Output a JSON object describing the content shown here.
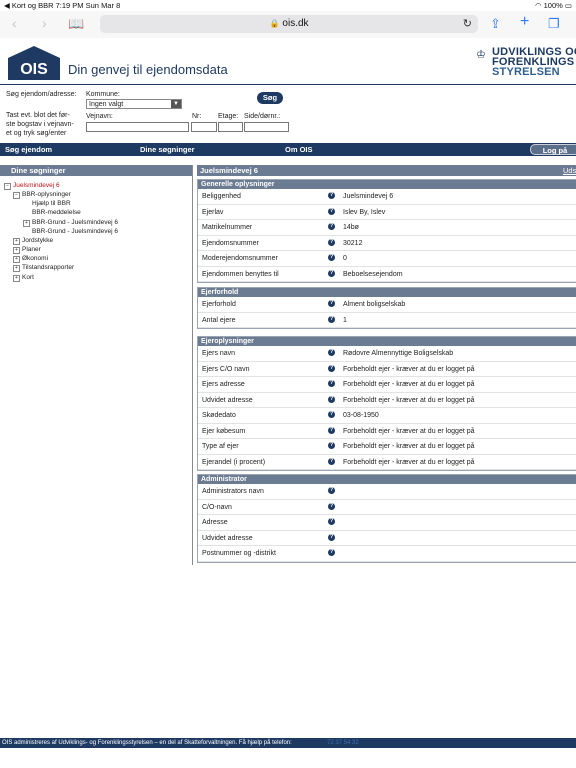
{
  "status": {
    "left": "◀ Kort og BBR   7:19 PM   Sun Mar 8",
    "right": "100%"
  },
  "browser": {
    "url": "ois.dk"
  },
  "header": {
    "logo_text": "OIS",
    "tagline": "Din genvej til ejendomsdata",
    "agency_line1": "UDVIKLINGS OG",
    "agency_line2": "FORENKLINGS",
    "agency_line3": "STYRELSEN"
  },
  "search": {
    "label_search": "Søg ejendom/adresse:",
    "label_kommune": "Kommune:",
    "kommune_selected": "Ingen valgt",
    "search_button": "Søg",
    "help_text_1": "Tast evt. blot det før-",
    "help_text_2": "ste bogstav i vejnavn-",
    "help_text_3": "et og tryk søg/enter",
    "label_vejnavn": "Vejnavn:",
    "label_nr": "Nr:",
    "label_etage": "Etage:",
    "label_side": "Side/dørnr.:"
  },
  "menu": {
    "sog_ejendom": "Søg ejendom",
    "dine_sogninger": "Dine søgninger",
    "om_ois": "Om OIS",
    "log_paa": "Log på"
  },
  "sidebar": {
    "title": "Dine søgninger",
    "tree": [
      {
        "box": "−",
        "label": "Juelsmindevej 6"
      },
      {
        "box": "−",
        "label": "BBR-oplysninger"
      },
      {
        "box": "",
        "label": "Hjælp til BBR"
      },
      {
        "box": "",
        "label": "BBR-meddelelse"
      },
      {
        "box": "+",
        "label": "BBR-Grund - Juelsmindevej 6"
      },
      {
        "box": "",
        "label": "BBR-Grund - Juelsmindevej 6"
      },
      {
        "box": "+",
        "label": "Jordstykke"
      },
      {
        "box": "+",
        "label": "Planer"
      },
      {
        "box": "+",
        "label": "Økonomi"
      },
      {
        "box": "+",
        "label": "Tilstandsrapporter"
      },
      {
        "box": "+",
        "label": "Kort"
      }
    ]
  },
  "main": {
    "title": "Juelsmindevej 6",
    "uds": "Uds",
    "sections": [
      {
        "title": "Generelle oplysninger",
        "rows": [
          {
            "k": "Beliggenhed",
            "v": "Juelsmindevej 6"
          },
          {
            "k": "Ejerlav",
            "v": "Islev By, Islev"
          },
          {
            "k": "Matrikelnummer",
            "v": "14bø"
          },
          {
            "k": "Ejendomsnummer",
            "v": "30212"
          },
          {
            "k": "Moderejendomsnummer",
            "v": "0"
          },
          {
            "k": "Ejendommen benyttes til",
            "v": "Beboelsesejendom"
          }
        ]
      },
      {
        "title": "Ejerforhold",
        "rows": [
          {
            "k": "Ejerforhold",
            "v": "Alment boligselskab"
          },
          {
            "k": "Antal ejere",
            "v": "1"
          }
        ]
      },
      {
        "title": "Ejeroplysninger",
        "rows": [
          {
            "k": "Ejers navn",
            "v": "Rødovre Almennyttige Boligselskab"
          },
          {
            "k": "Ejers C/O navn",
            "v": "Forbeholdt ejer - kræver at du er logget på"
          },
          {
            "k": "Ejers adresse",
            "v": "Forbeholdt ejer - kræver at du er logget på"
          },
          {
            "k": "Udvidet adresse",
            "v": "Forbeholdt ejer - kræver at du er logget på"
          },
          {
            "k": "Skødedato",
            "v": "03-08-1950"
          },
          {
            "k": "Ejer købesum",
            "v": "Forbeholdt ejer - kræver at du er logget på"
          },
          {
            "k": "Type af ejer",
            "v": "Forbeholdt ejer - kræver at du er logget på"
          },
          {
            "k": "Ejerandel (i procent)",
            "v": "Forbeholdt ejer - kræver at du er logget på"
          }
        ]
      },
      {
        "title": "Administrator",
        "rows": [
          {
            "k": "Administrators navn",
            "v": ""
          },
          {
            "k": "C/O-navn",
            "v": ""
          },
          {
            "k": "Adresse",
            "v": ""
          },
          {
            "k": "Udvidet adresse",
            "v": ""
          },
          {
            "k": "Postnummer og -distrikt",
            "v": ""
          }
        ]
      }
    ]
  },
  "footer": {
    "text": "OIS administreres af Udviklings- og Forenklingsstyrelsen – en del af Skatteforvaltningen. Få hjælp på telefon:",
    "phone": "72 37 54 32"
  },
  "colors": {
    "navy": "#1e3a63",
    "section_header": "#6b7b92",
    "link_red": "#c0141a"
  }
}
